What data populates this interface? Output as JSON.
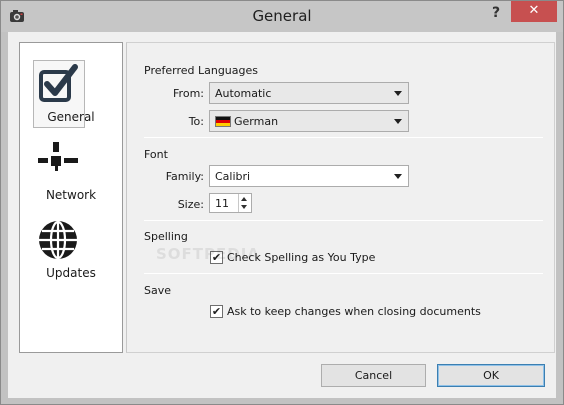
{
  "window": {
    "title": "General",
    "help_label": "?",
    "close_label": "✕",
    "app_icon": "camera-app-icon"
  },
  "nav": {
    "items": [
      {
        "label": "General",
        "icon": "checkbox-icon",
        "active": true
      },
      {
        "label": "Network",
        "icon": "network-icon",
        "active": false
      },
      {
        "label": "Updates",
        "icon": "globe-icon",
        "active": false
      }
    ]
  },
  "languages": {
    "section_title": "Preferred Languages",
    "from_label": "From:",
    "from_value": "Automatic",
    "to_label": "To:",
    "to_value": "German"
  },
  "font": {
    "section_title": "Font",
    "family_label": "Family:",
    "family_value": "Calibri",
    "size_label": "Size:",
    "size_value": "11"
  },
  "spelling": {
    "section_title": "Spelling",
    "check_label": "Check Spelling as You Type",
    "checked": true
  },
  "save": {
    "section_title": "Save",
    "ask_label": "Ask to keep changes when closing documents",
    "checked": true
  },
  "buttons": {
    "cancel": "Cancel",
    "ok": "OK"
  },
  "watermark": "SOFTPEDIA",
  "colors": {
    "close_button": "#c75050",
    "default_button_border": "#3c7fb1"
  }
}
